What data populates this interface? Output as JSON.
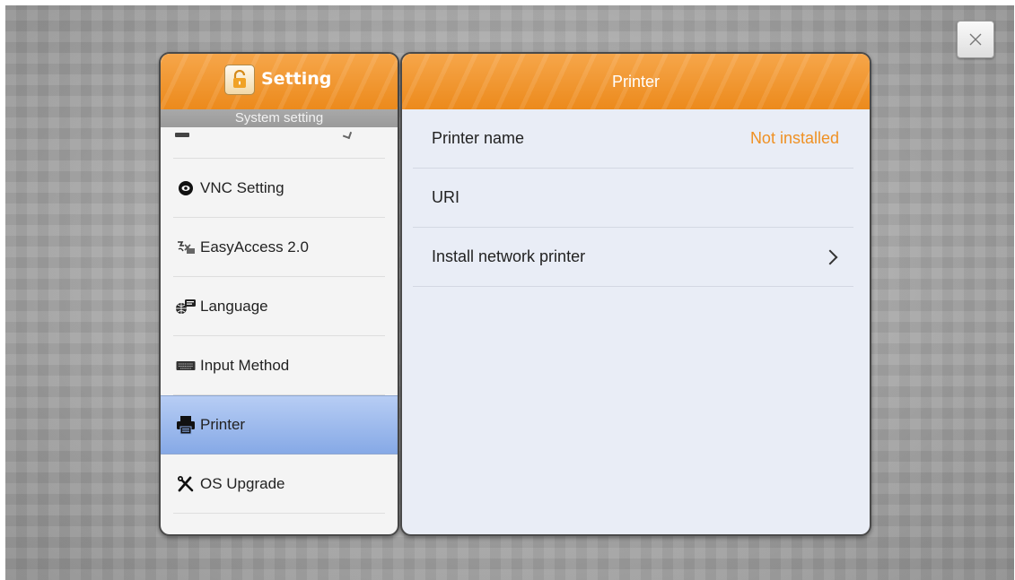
{
  "left_panel": {
    "title": "Setting",
    "subtitle": "System setting",
    "items": [
      {
        "label": "VNC Setting",
        "icon": "vnc-icon"
      },
      {
        "label": "EasyAccess 2.0",
        "icon": "easyaccess-icon"
      },
      {
        "label": "Language",
        "icon": "language-icon"
      },
      {
        "label": "Input Method",
        "icon": "keyboard-icon"
      },
      {
        "label": "Printer",
        "icon": "printer-icon",
        "selected": true
      },
      {
        "label": "OS Upgrade",
        "icon": "tools-icon"
      }
    ]
  },
  "right_panel": {
    "title": "Printer",
    "rows": [
      {
        "label": "Printer name",
        "value": "Not installed"
      },
      {
        "label": "URI",
        "value": ""
      },
      {
        "label": "Install network printer",
        "value": ""
      }
    ]
  },
  "colors": {
    "accent_orange": "#ec8a1c",
    "value_orange": "#ef9124",
    "selected_blue": "#86a9e6"
  }
}
